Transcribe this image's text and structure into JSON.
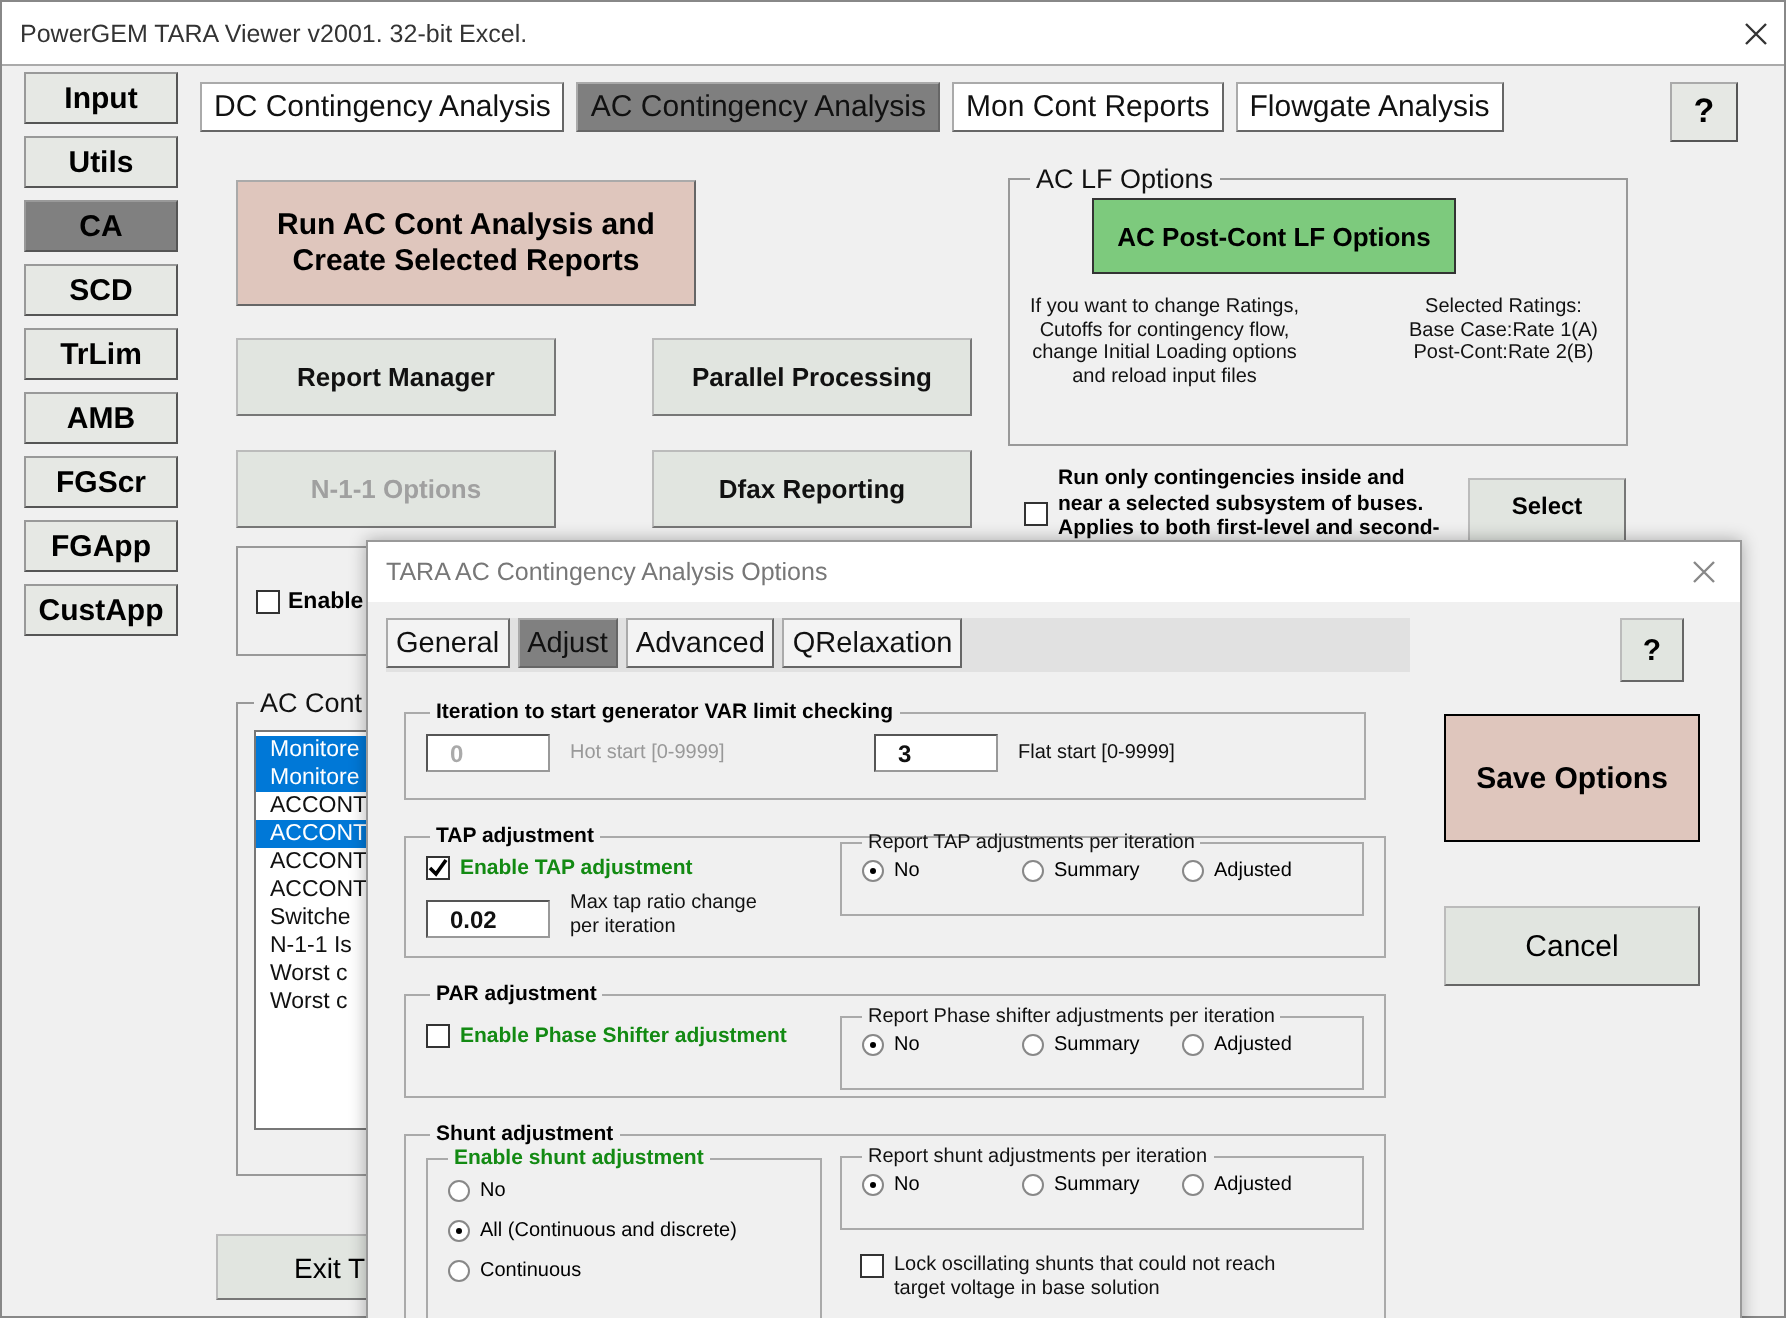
{
  "window": {
    "title": "PowerGEM TARA Viewer v2001. 32-bit Excel."
  },
  "sidebar": {
    "items": [
      {
        "label": "Input",
        "selected": false
      },
      {
        "label": "Utils",
        "selected": false
      },
      {
        "label": "CA",
        "selected": true
      },
      {
        "label": "SCD",
        "selected": false
      },
      {
        "label": "TrLim",
        "selected": false
      },
      {
        "label": "AMB",
        "selected": false
      },
      {
        "label": "FGScr",
        "selected": false
      },
      {
        "label": "FGApp",
        "selected": false
      },
      {
        "label": "CustApp",
        "selected": false
      }
    ]
  },
  "tabs": [
    {
      "label": "DC Contingency Analysis",
      "selected": false
    },
    {
      "label": "AC Contingency Analysis",
      "selected": true
    },
    {
      "label": "Mon Cont Reports",
      "selected": false
    },
    {
      "label": "Flowgate Analysis",
      "selected": false
    }
  ],
  "help_button": "?",
  "run_button": {
    "lines": [
      "Run AC Cont Analysis and",
      "Create Selected Reports"
    ]
  },
  "buttons": [
    {
      "label": "Report Manager",
      "disabled": false
    },
    {
      "label": "Parallel Processing",
      "disabled": false
    },
    {
      "label": "N-1-1 Options",
      "disabled": true
    },
    {
      "label": "Dfax Reporting",
      "disabled": false
    }
  ],
  "lf_options": {
    "title": "AC LF Options",
    "button": "AC Post-Cont LF Options",
    "note": [
      "If you want to change Ratings,",
      "Cutoffs for contingency flow,",
      "change Initial Loading options",
      "and reload input files"
    ],
    "ratings": [
      "Selected Ratings:",
      "Base Case:Rate 1(A)",
      "Post-Cont:Rate 2(B)"
    ]
  },
  "subsystem": {
    "checked": false,
    "lines": [
      "Run only contingencies inside and",
      "near a selected subsystem of buses.",
      "Applies to both first-level and second-"
    ],
    "button": "Select"
  },
  "enable_box": {
    "checked": false,
    "label": "Enable"
  },
  "contingency_list": {
    "title": "AC Cont",
    "items": [
      {
        "label": "Monitore",
        "selected": true
      },
      {
        "label": "Monitore",
        "selected": true
      },
      {
        "label": "ACCONT",
        "selected": false
      },
      {
        "label": "ACCONT",
        "selected": true
      },
      {
        "label": "ACCONT",
        "selected": false
      },
      {
        "label": "ACCONT",
        "selected": false
      },
      {
        "label": "Switche",
        "selected": false
      },
      {
        "label": "N-1-1 Is",
        "selected": false
      },
      {
        "label": "Worst c",
        "selected": false
      },
      {
        "label": "Worst c",
        "selected": false
      }
    ]
  },
  "exit_button": "Exit T",
  "dialog": {
    "title": "TARA AC Contingency Analysis Options",
    "tabs": [
      {
        "label": "General",
        "selected": false
      },
      {
        "label": "Adjust",
        "selected": true
      },
      {
        "label": "Advanced",
        "selected": false
      },
      {
        "label": "QRelaxation",
        "selected": false
      }
    ],
    "help_button": "?",
    "save_button": "Save Options",
    "cancel_button": "Cancel",
    "var_limit": {
      "title": "Iteration to start generator VAR limit checking",
      "fields": [
        {
          "value": "0",
          "note": "Hot start [0-9999]",
          "disabled": true
        },
        {
          "value": "3",
          "note": "Flat start [0-9999]",
          "disabled": false
        }
      ]
    },
    "tap": {
      "title": "TAP adjustment",
      "enable": {
        "label": "Enable TAP adjustment",
        "checked": true
      },
      "max_change": {
        "value": "0.02",
        "lines": [
          "Max tap ratio change",
          "per iteration"
        ]
      },
      "report": {
        "title": "Report TAP adjustments per iteration",
        "options": [
          {
            "label": "No",
            "selected": true
          },
          {
            "label": "Summary",
            "selected": false
          },
          {
            "label": "Adjusted",
            "selected": false
          }
        ]
      }
    },
    "par": {
      "title": "PAR adjustment",
      "enable": {
        "label": "Enable Phase Shifter adjustment",
        "checked": false
      },
      "report": {
        "title": "Report Phase shifter adjustments per iteration",
        "options": [
          {
            "label": "No",
            "selected": true
          },
          {
            "label": "Summary",
            "selected": false
          },
          {
            "label": "Adjusted",
            "selected": false
          }
        ]
      }
    },
    "shunt": {
      "title": "Shunt adjustment",
      "enable": {
        "title": "Enable shunt adjustment",
        "options": [
          {
            "label": "No",
            "selected": false
          },
          {
            "label": "All (Continuous and discrete)",
            "selected": true
          },
          {
            "label": "Continuous",
            "selected": false
          }
        ]
      },
      "report": {
        "title": "Report shunt adjustments per iteration",
        "options": [
          {
            "label": "No",
            "selected": true
          },
          {
            "label": "Summary",
            "selected": false
          },
          {
            "label": "Adjusted",
            "selected": false
          }
        ]
      },
      "lock": {
        "lines": [
          "Lock oscillating shunts that could not reach",
          "target voltage in base solution"
        ],
        "checked": false
      }
    }
  }
}
